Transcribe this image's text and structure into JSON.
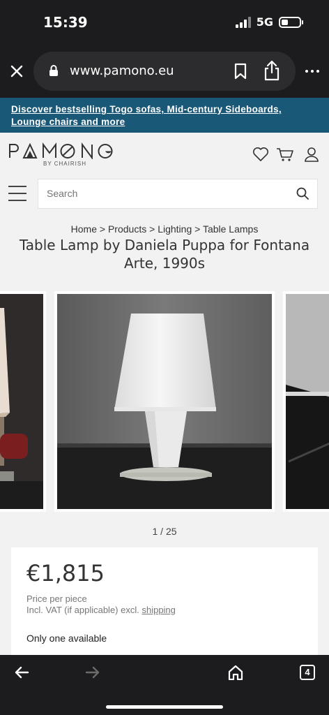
{
  "status": {
    "time": "15:39",
    "network": "5G"
  },
  "browser": {
    "url": "www.pamono.eu",
    "tab_count": "4",
    "icons": [
      "close-icon",
      "lock-icon",
      "bookmark-icon",
      "share-icon",
      "more-icon",
      "back-icon",
      "forward-icon",
      "home-icon",
      "tabs-icon"
    ]
  },
  "promo": {
    "line1": "Discover bestselling Togo sofas, Mid-century Sideboards,",
    "line2": "Lounge chairs and more"
  },
  "header": {
    "logo": "PAMONO",
    "logo_sub": "BY CHAIRISH",
    "icons": [
      "heart-icon",
      "cart-icon",
      "user-icon",
      "menu-icon",
      "search-icon"
    ]
  },
  "search": {
    "placeholder": "Search"
  },
  "breadcrumb": [
    "Home",
    "Products",
    "Lighting",
    "Table Lamps"
  ],
  "breadcrumb_separator": ">",
  "product": {
    "title_line1": "Table Lamp by Daniela Puppa for Fontana",
    "title_line2": "Arte, 1990s",
    "counter": "1 / 25",
    "price": "€1,815",
    "price_per": "Price per piece",
    "vat_note": "Incl. VAT (if applicable) excl.",
    "shipping_link": "shipping",
    "availability": "Only one available"
  },
  "colors": {
    "promo_bg": "#1a5878",
    "page_bg": "#f2f2f2",
    "chrome_bg": "#1c1c1e"
  }
}
